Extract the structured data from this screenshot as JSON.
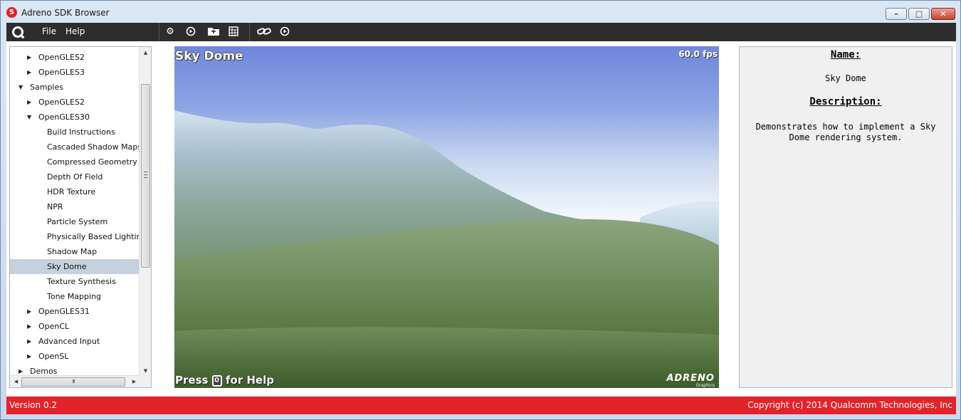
{
  "window": {
    "title": "Adreno SDK Browser",
    "app_icon": "snapdragon-icon",
    "controls": [
      "minimize",
      "maximize",
      "close"
    ]
  },
  "menubar": {
    "logo_icon": "qualcomm-q-icon",
    "menus": [
      {
        "label": "File"
      },
      {
        "label": "Help"
      }
    ],
    "toolbar_icons": [
      "settings-gear-icon",
      "play-circle-icon",
      "folder-open-icon",
      "grid-view-icon",
      "link-icon",
      "play-circle-icon"
    ]
  },
  "tree": {
    "items": [
      {
        "label": "OpenGLES2",
        "level": 1,
        "expander": "collapsed"
      },
      {
        "label": "OpenGLES3",
        "level": 1,
        "expander": "collapsed"
      },
      {
        "label": "Samples",
        "level": 0,
        "expander": "expanded"
      },
      {
        "label": "OpenGLES2",
        "level": 1,
        "expander": "collapsed"
      },
      {
        "label": "OpenGLES30",
        "level": 1,
        "expander": "expanded"
      },
      {
        "label": "Build Instructions",
        "level": 2,
        "expander": "none"
      },
      {
        "label": "Cascaded Shadow Maps",
        "level": 2,
        "expander": "none"
      },
      {
        "label": "Compressed Geometry",
        "level": 2,
        "expander": "none"
      },
      {
        "label": "Depth Of Field",
        "level": 2,
        "expander": "none"
      },
      {
        "label": "HDR Texture",
        "level": 2,
        "expander": "none"
      },
      {
        "label": "NPR",
        "level": 2,
        "expander": "none"
      },
      {
        "label": "Particle System",
        "level": 2,
        "expander": "none"
      },
      {
        "label": "Physically Based Lighting",
        "level": 2,
        "expander": "none"
      },
      {
        "label": "Shadow Map",
        "level": 2,
        "expander": "none"
      },
      {
        "label": "Sky Dome",
        "level": 2,
        "expander": "none",
        "selected": true
      },
      {
        "label": "Texture Synthesis",
        "level": 2,
        "expander": "none"
      },
      {
        "label": "Tone Mapping",
        "level": 2,
        "expander": "none"
      },
      {
        "label": "OpenGLES31",
        "level": 1,
        "expander": "collapsed"
      },
      {
        "label": "OpenCL",
        "level": 1,
        "expander": "collapsed"
      },
      {
        "label": "Advanced Input",
        "level": 1,
        "expander": "collapsed"
      },
      {
        "label": "OpenSL",
        "level": 1,
        "expander": "collapsed"
      },
      {
        "label": "Demos",
        "level": 0,
        "expander": "collapsed"
      }
    ],
    "hscroll_grip": "III"
  },
  "viewport": {
    "scene_title": "Sky Dome",
    "fps": "60.0 fps",
    "help_prefix": "Press",
    "help_key": "0",
    "help_suffix": "for Help",
    "logo_text": "ADRENO",
    "logo_sub": "Graphics"
  },
  "info": {
    "name_heading": "Name:",
    "name_value": "Sky Dome",
    "description_heading": "Description:",
    "description": "Demonstrates how to implement a Sky Dome rendering system."
  },
  "status": {
    "version": "Version 0.2",
    "copyright": "Copyright (c) 2014 Qualcomm Technologies, Inc"
  },
  "colors": {
    "brand_red": "#e2232a",
    "menubar_bg": "#2d2d2d",
    "selection": "#c5d1dd"
  }
}
